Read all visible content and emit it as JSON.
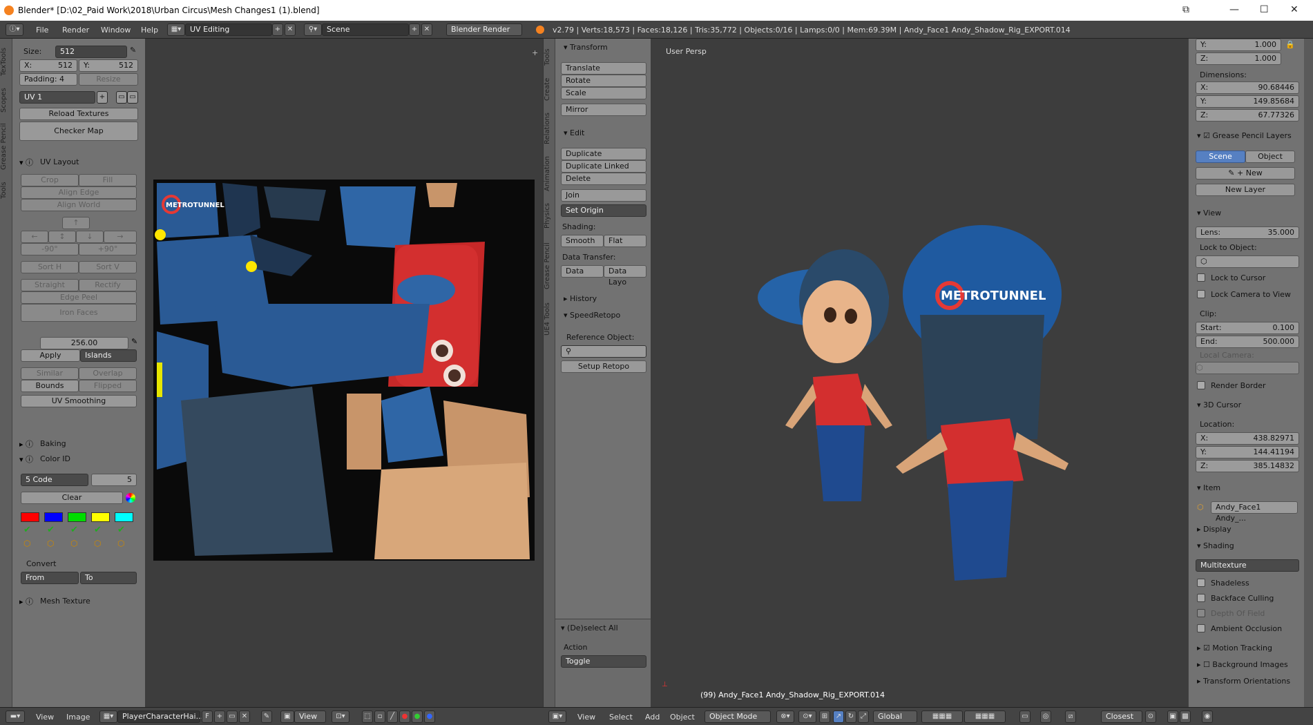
{
  "title": {
    "text": "Blender* [D:\\02_Paid Work\\2018\\Urban Circus\\Mesh Changes1 (1).blend]"
  },
  "topbar": {
    "menus": [
      "File",
      "Render",
      "Window",
      "Help"
    ],
    "layout": "UV Editing",
    "scene": "Scene",
    "engine": "Blender Render",
    "stats": "v2.79 | Verts:18,573 | Faces:18,126 | Tris:35,772 | Objects:0/16 | Lamps:0/0 | Mem:69.39M | Andy_Face1 Andy_Shadow_Rig_EXPORT.014"
  },
  "left_tabs": [
    "TexTools",
    "Scopes",
    "Grease Pencil",
    "Tools"
  ],
  "texpanel": {
    "size_label": "Size:",
    "size_value": "512",
    "x_label": "X:",
    "x_value": "512",
    "y_label": "Y:",
    "y_value": "512",
    "padding": "Padding:  4",
    "resize": "Resize",
    "uv_map": "UV 1",
    "reload": "Reload Textures",
    "checker": "Checker Map",
    "uv_layout": "UV Layout",
    "crop": "Crop",
    "fill": "Fill",
    "align_edge": "Align Edge",
    "align_world": "Align World",
    "rot_neg": "-90°",
    "rot_pos": "+90°",
    "sort_h": "Sort H",
    "sort_v": "Sort V",
    "straight": "Straight",
    "rectify": "Rectify",
    "edge_peel": "Edge Peel",
    "iron_faces": "Iron Faces",
    "texel_value": "256.00",
    "apply": "Apply",
    "islands": "Islands",
    "similar": "Similar",
    "overlap": "Overlap",
    "bounds": "Bounds",
    "flipped": "Flipped",
    "uv_smoothing": "UV Smoothing",
    "baking": "Baking",
    "color_id": "Color ID",
    "code_mode": "5 Code",
    "code_count": "5",
    "clear": "Clear",
    "swatches": [
      "#ff0000",
      "#0000ff",
      "#00dd00",
      "#ffff00",
      "#00ffff"
    ],
    "convert": "Convert",
    "from": "From",
    "to": "To",
    "mesh_texture": "Mesh Texture"
  },
  "uv_bottom": {
    "view": "View",
    "image": "Image",
    "image_name": "PlayerCharacterHai...",
    "f": "F"
  },
  "mid_tabs": [
    "Tools",
    "Create",
    "Relations",
    "Animation",
    "Physics",
    "Grease Pencil",
    "UE4 Tools"
  ],
  "toolpanel": {
    "transform": "Transform",
    "translate": "Translate",
    "rotate": "Rotate",
    "scale": "Scale",
    "mirror": "Mirror",
    "edit": "Edit",
    "duplicate": "Duplicate",
    "duplicate_linked": "Duplicate Linked",
    "delete": "Delete",
    "join": "Join",
    "set_origin": "Set Origin",
    "shading": "Shading:",
    "smooth": "Smooth",
    "flat": "Flat",
    "data_transfer": "Data Transfer:",
    "data": "Data",
    "data_layo": "Data Layo",
    "history": "History",
    "speedretopo": "SpeedRetopo",
    "reference_object": "Reference Object:",
    "setup_retopo": "Setup Retopo",
    "deselect_all": "(De)select All",
    "action": "Action",
    "toggle": "Toggle"
  },
  "viewport": {
    "persp": "User Persp",
    "object_info": "(99) Andy_Face1 Andy_Shadow_Rig_EXPORT.014",
    "logo_text": "METROTUNNEL"
  },
  "view3d_bottom": {
    "view": "View",
    "select": "Select",
    "add": "Add",
    "object": "Object",
    "mode": "Object Mode",
    "orient": "Global",
    "snap": "Closest"
  },
  "props": {
    "scale_y_label": "Y:",
    "scale_y": "1.000",
    "scale_z_label": "Z:",
    "scale_z": "1.000",
    "dimensions": "Dimensions:",
    "dim_x": "90.68446",
    "dim_y": "149.85684",
    "dim_z": "67.77326",
    "gp_layers": "Grease Pencil Layers",
    "scene_btn": "Scene",
    "object_btn": "Object",
    "new": "New",
    "new_layer": "New Layer",
    "view": "View",
    "lens_label": "Lens:",
    "lens": "35.000",
    "lock_to_object": "Lock to Object:",
    "lock_to_cursor": "Lock to Cursor",
    "lock_camera": "Lock Camera to View",
    "clip": "Clip:",
    "start_label": "Start:",
    "start": "0.100",
    "end_label": "End:",
    "end": "500.000",
    "local_camera": "Local Camera:",
    "render_border": "Render Border",
    "cursor_3d": "3D Cursor",
    "location": "Location:",
    "loc_x": "438.82971",
    "loc_y": "144.41194",
    "loc_z": "385.14832",
    "item": "Item",
    "item_name": "Andy_Face1 Andy_...",
    "display": "Display",
    "shading": "Shading",
    "multitexture": "Multitexture",
    "shadeless": "Shadeless",
    "backface": "Backface Culling",
    "dof": "Depth Of Field",
    "ao": "Ambient Occlusion",
    "motion_tracking": "Motion Tracking",
    "background_images": "Background Images",
    "transform_orient": "Transform Orientations"
  }
}
